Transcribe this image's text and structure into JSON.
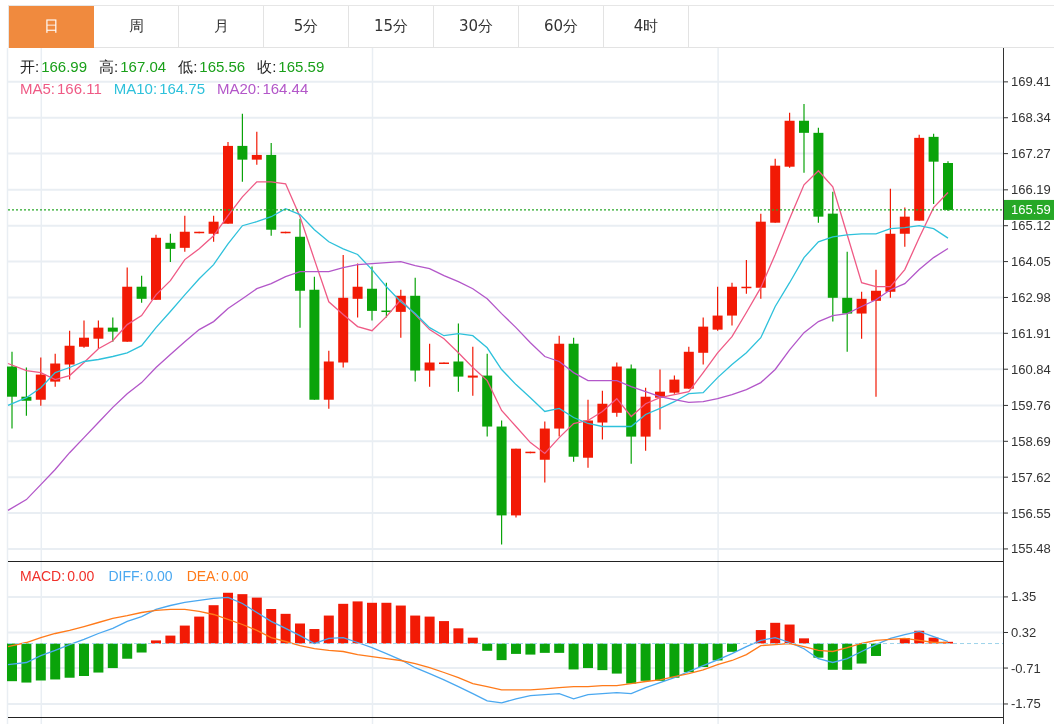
{
  "tabs": [
    {
      "label": "日",
      "selected": true
    },
    {
      "label": "周",
      "selected": false
    },
    {
      "label": "月",
      "selected": false
    },
    {
      "label": "5分",
      "selected": false
    },
    {
      "label": "15分",
      "selected": false
    },
    {
      "label": "30分",
      "selected": false
    },
    {
      "label": "60分",
      "selected": false
    },
    {
      "label": "4时",
      "selected": false
    }
  ],
  "ohlc_legend": [
    {
      "label": "开:",
      "value": "166.99"
    },
    {
      "label": "高:",
      "value": "167.04"
    },
    {
      "label": "低:",
      "value": "165.56"
    },
    {
      "label": "收:",
      "value": "165.59"
    }
  ],
  "ma_legend": [
    {
      "value": "166.11",
      "color": "#ef5a85"
    },
    {
      "value": "164.75",
      "color": "#2ec1db"
    },
    {
      "value": "164.44",
      "color": "#b357c9"
    }
  ],
  "main_chart": {
    "chart_data": {
      "type": "candlestick",
      "ylim": [
        155.12,
        170.42
      ],
      "grid": true,
      "yticks": [
        169.41,
        168.34,
        167.27,
        166.19,
        165.12,
        164.05,
        162.98,
        161.91,
        160.84,
        159.76,
        158.69,
        157.62,
        156.55,
        155.48
      ],
      "series": [
        {
          "name": "MA5:",
          "type": "line",
          "color": "#ef5a85",
          "values": [
            161.01,
            160.8,
            160.74,
            160.53,
            160.65,
            161.04,
            161.45,
            161.69,
            162.17,
            162.44,
            163.06,
            163.48,
            164.11,
            164.43,
            164.82,
            165.42,
            165.98,
            166.43,
            166.43,
            166.37,
            165.39,
            164.11,
            162.85,
            162.47,
            162.11,
            161.99,
            162.41,
            162.91,
            162.47,
            162.02,
            161.75,
            161.33,
            160.89,
            160.5,
            159.61,
            159.13,
            158.65,
            158.33,
            158.8,
            159.22,
            159.31,
            159.58,
            159.96,
            159.43,
            159.81,
            159.99,
            160.08,
            160.17,
            160.74,
            161.33,
            161.81,
            162.53,
            163.27,
            164.26,
            165.33,
            166.34,
            166.76,
            166.28,
            164.85,
            163.42,
            163.3,
            163.3,
            163.81,
            164.76,
            165.66,
            166.11
          ]
        },
        {
          "name": "MA10:",
          "type": "line",
          "color": "#2ec1db",
          "values": [
            159.76,
            159.99,
            160.29,
            160.74,
            160.89,
            161.07,
            161.13,
            161.22,
            161.33,
            161.54,
            162.08,
            162.56,
            163.06,
            163.54,
            163.96,
            164.58,
            165.12,
            165.24,
            165.39,
            165.63,
            165.45,
            165.0,
            164.64,
            164.43,
            164.26,
            163.81,
            163.3,
            162.85,
            162.5,
            162.08,
            161.84,
            161.9,
            161.84,
            161.48,
            160.83,
            160.38,
            159.99,
            159.58,
            159.67,
            159.4,
            159.22,
            159.13,
            159.13,
            159.13,
            159.49,
            159.67,
            159.87,
            160.11,
            160.14,
            160.59,
            160.98,
            161.33,
            161.78,
            162.71,
            163.42,
            164.17,
            164.64,
            164.79,
            164.85,
            164.88,
            164.88,
            165.03,
            165.06,
            165.12,
            165.03,
            164.75
          ]
        },
        {
          "name": "MA20:",
          "type": "line",
          "color": "#b357c9",
          "values": [
            156.63,
            156.95,
            157.4,
            157.85,
            158.35,
            158.8,
            159.25,
            159.7,
            160.11,
            160.44,
            160.89,
            161.28,
            161.66,
            162.02,
            162.26,
            162.65,
            162.94,
            163.24,
            163.39,
            163.6,
            163.75,
            163.75,
            163.75,
            163.87,
            163.96,
            163.99,
            164.02,
            164.05,
            163.93,
            163.84,
            163.63,
            163.45,
            163.24,
            162.94,
            162.5,
            162.08,
            161.63,
            161.22,
            161.07,
            160.74,
            160.5,
            160.5,
            160.5,
            160.32,
            160.17,
            160.02,
            159.93,
            159.85,
            159.87,
            159.96,
            160.08,
            160.23,
            160.44,
            160.83,
            161.42,
            161.93,
            162.26,
            162.44,
            162.5,
            162.71,
            162.91,
            163.21,
            163.39,
            163.81,
            164.17,
            164.44
          ]
        }
      ],
      "ohlc": [
        [
          160.92,
          161.36,
          159.07,
          160.02
        ],
        [
          160.02,
          160.89,
          159.45,
          159.9
        ],
        [
          159.93,
          161.19,
          159.75,
          160.68
        ],
        [
          160.47,
          161.3,
          160.32,
          161.01
        ],
        [
          160.98,
          161.99,
          160.53,
          161.54
        ],
        [
          161.51,
          162.29,
          161.48,
          161.78
        ],
        [
          161.75,
          162.29,
          161.45,
          162.08
        ],
        [
          162.08,
          162.38,
          161.66,
          161.96
        ],
        [
          161.66,
          163.87,
          161.66,
          163.3
        ],
        [
          163.3,
          163.63,
          162.82,
          162.94
        ],
        [
          162.91,
          164.85,
          162.91,
          164.76
        ],
        [
          164.61,
          164.88,
          164.04,
          164.43
        ],
        [
          164.46,
          165.42,
          164.34,
          164.94
        ],
        [
          164.93,
          164.94,
          164.93,
          164.94
        ],
        [
          164.88,
          165.42,
          164.64,
          165.24
        ],
        [
          165.18,
          167.62,
          165.18,
          167.5
        ],
        [
          167.5,
          168.46,
          166.43,
          167.09
        ],
        [
          167.09,
          167.92,
          166.94,
          167.23
        ],
        [
          167.23,
          167.59,
          164.82,
          165.0
        ],
        [
          164.93,
          164.94,
          164.93,
          164.94
        ],
        [
          164.79,
          165.33,
          162.08,
          163.18
        ],
        [
          163.21,
          163.6,
          159.93,
          159.93
        ],
        [
          159.93,
          161.39,
          159.66,
          161.07
        ],
        [
          161.04,
          164.25,
          160.89,
          162.97
        ],
        [
          162.94,
          163.99,
          162.38,
          163.3
        ],
        [
          163.24,
          163.9,
          162.29,
          162.58
        ],
        [
          162.59,
          163.42,
          162.38,
          162.58
        ],
        [
          162.55,
          163.21,
          161.78,
          163.03
        ],
        [
          163.03,
          163.57,
          160.47,
          160.8
        ],
        [
          160.8,
          161.6,
          160.32,
          161.04
        ],
        [
          161.03,
          161.04,
          161.03,
          161.04
        ],
        [
          161.07,
          162.2,
          160.17,
          160.62
        ],
        [
          160.59,
          161.51,
          160.05,
          160.65
        ],
        [
          160.65,
          161.3,
          158.83,
          159.13
        ],
        [
          159.13,
          159.31,
          155.61,
          156.48
        ],
        [
          156.48,
          158.47,
          156.42,
          158.47
        ],
        [
          158.37,
          158.38,
          158.37,
          158.38
        ],
        [
          158.14,
          159.28,
          157.46,
          159.07
        ],
        [
          159.07,
          161.84,
          158.83,
          161.6
        ],
        [
          161.6,
          161.78,
          158.08,
          158.23
        ],
        [
          158.2,
          159.93,
          157.9,
          159.31
        ],
        [
          159.25,
          160.2,
          158.74,
          159.81
        ],
        [
          159.54,
          161.04,
          159.42,
          160.92
        ],
        [
          160.86,
          160.98,
          158.02,
          158.83
        ],
        [
          158.83,
          160.29,
          158.41,
          160.02
        ],
        [
          159.99,
          160.83,
          159.04,
          160.17
        ],
        [
          160.14,
          160.65,
          160.11,
          160.53
        ],
        [
          160.26,
          161.51,
          160.26,
          161.36
        ],
        [
          161.33,
          162.38,
          160.98,
          162.11
        ],
        [
          162.02,
          163.3,
          161.99,
          162.44
        ],
        [
          162.44,
          163.42,
          162.14,
          163.3
        ],
        [
          163.29,
          164.1,
          163.09,
          163.3
        ],
        [
          163.27,
          165.48,
          162.94,
          165.24
        ],
        [
          165.21,
          167.12,
          165.21,
          166.91
        ],
        [
          166.88,
          168.49,
          166.85,
          168.25
        ],
        [
          168.25,
          168.75,
          166.7,
          167.89
        ],
        [
          167.89,
          168.04,
          165.21,
          165.39
        ],
        [
          165.48,
          166.13,
          162.26,
          162.97
        ],
        [
          162.97,
          164.34,
          161.36,
          162.5
        ],
        [
          162.5,
          163.15,
          161.75,
          162.94
        ],
        [
          162.88,
          163.81,
          160.02,
          163.18
        ],
        [
          163.15,
          166.22,
          162.97,
          164.88
        ],
        [
          164.88,
          165.66,
          164.49,
          165.39
        ],
        [
          165.27,
          167.83,
          165.27,
          167.74
        ],
        [
          167.77,
          167.86,
          165.77,
          167.03
        ],
        [
          166.99,
          167.04,
          165.56,
          165.59
        ]
      ],
      "ref_lines": [
        {
          "axis": "y",
          "value": 165.59,
          "label": "165.59",
          "color": "#27a827"
        }
      ]
    }
  },
  "macd_legend": [
    {
      "value": "0.00",
      "color": "#f0302a"
    },
    {
      "value": "0.00",
      "color": "#4aa8f0"
    },
    {
      "value": "0.00",
      "color": "#ff7a1a"
    }
  ],
  "macd_chart": {
    "chart_data": {
      "type": "bar",
      "ylim": [
        -2.33,
        2.39
      ],
      "grid": true,
      "ref_lines": [
        {
          "axis": "y",
          "value": 0,
          "color": "#9dd3ea"
        }
      ],
      "yticks": [
        1.35,
        0.32,
        -0.71,
        -1.75
      ],
      "series": [
        {
          "name": "MACD:",
          "colors": [
            "#0aa30a",
            "#0aa30a",
            "#0aa30a",
            "#0aa30a",
            "#0aa30a",
            "#0aa30a",
            "#0aa30a",
            "#0aa30a",
            "#0aa30a",
            "#0aa30a",
            "#f21a05",
            "#f21a05",
            "#f21a05",
            "#f21a05",
            "#f21a05",
            "#f21a05",
            "#f21a05",
            "#f21a05",
            "#f21a05",
            "#f21a05",
            "#f21a05",
            "#f21a05",
            "#f21a05",
            "#f21a05",
            "#f21a05",
            "#f21a05",
            "#f21a05",
            "#f21a05",
            "#f21a05",
            "#f21a05",
            "#f21a05",
            "#f21a05",
            "#f21a05",
            "#0aa30a",
            "#0aa30a",
            "#0aa30a",
            "#0aa30a",
            "#0aa30a",
            "#0aa30a",
            "#0aa30a",
            "#0aa30a",
            "#0aa30a",
            "#0aa30a",
            "#0aa30a",
            "#0aa30a",
            "#0aa30a",
            "#0aa30a",
            "#0aa30a",
            "#0aa30a",
            "#0aa30a",
            "#0aa30a",
            null,
            "#f21a05",
            "#f21a05",
            "#f21a05",
            "#f21a05",
            "#0aa30a",
            "#0aa30a",
            "#0aa30a",
            "#0aa30a",
            "#0aa30a",
            null,
            "#f21a05",
            "#f21a05",
            "#f21a05",
            "#f21a05"
          ],
          "values": [
            -1.09,
            -1.13,
            -1.07,
            -1.04,
            -0.99,
            -0.94,
            -0.84,
            -0.71,
            -0.44,
            -0.26,
            0.09,
            0.23,
            0.52,
            0.78,
            1.11,
            1.47,
            1.43,
            1.33,
            1.0,
            0.86,
            0.58,
            0.42,
            0.81,
            1.15,
            1.22,
            1.18,
            1.18,
            1.1,
            0.81,
            0.78,
            0.65,
            0.44,
            0.17,
            -0.21,
            -0.48,
            -0.3,
            -0.32,
            -0.27,
            -0.27,
            -0.75,
            -0.71,
            -0.77,
            -0.87,
            -1.16,
            -1.08,
            -1.08,
            -0.99,
            -0.83,
            -0.68,
            -0.49,
            -0.24,
            null,
            0.39,
            0.6,
            0.55,
            0.15,
            -0.41,
            -0.76,
            -0.76,
            -0.58,
            -0.36,
            null,
            0.16,
            0.37,
            0.17,
            0.05
          ]
        },
        {
          "name": "DIFF:",
          "type": "line",
          "color": "#4aa8f0",
          "values": [
            -0.61,
            -0.55,
            -0.35,
            -0.2,
            -0.03,
            0.12,
            0.29,
            0.44,
            0.64,
            0.78,
            0.99,
            1.1,
            1.19,
            1.25,
            1.31,
            1.34,
            1.16,
            0.9,
            0.64,
            0.44,
            0.23,
            0.0,
            0.15,
            0.17,
            0.03,
            -0.12,
            -0.29,
            -0.47,
            -0.7,
            -0.87,
            -1.05,
            -1.25,
            -1.45,
            -1.66,
            -1.72,
            -1.6,
            -1.51,
            -1.48,
            -1.45,
            -1.6,
            -1.48,
            -1.45,
            -1.42,
            -1.45,
            -1.28,
            -1.13,
            -0.99,
            -0.81,
            -0.64,
            -0.47,
            -0.29,
            -0.09,
            0.09,
            0.17,
            0.03,
            -0.15,
            -0.44,
            -0.55,
            -0.44,
            -0.23,
            -0.03,
            0.15,
            0.26,
            0.35,
            0.2,
            0.06
          ]
        },
        {
          "name": "DEA:",
          "type": "line",
          "color": "#ff7a1a",
          "values": [
            -0.09,
            0.03,
            0.17,
            0.29,
            0.38,
            0.49,
            0.61,
            0.73,
            0.81,
            0.9,
            0.96,
            0.99,
            0.99,
            0.93,
            0.84,
            0.7,
            0.55,
            0.38,
            0.17,
            0.06,
            -0.06,
            -0.15,
            -0.2,
            -0.23,
            -0.32,
            -0.38,
            -0.44,
            -0.49,
            -0.58,
            -0.7,
            -0.84,
            -0.99,
            -1.16,
            -1.25,
            -1.34,
            -1.34,
            -1.34,
            -1.31,
            -1.28,
            -1.25,
            -1.25,
            -1.22,
            -1.22,
            -1.16,
            -1.1,
            -1.05,
            -0.96,
            -0.87,
            -0.76,
            -0.61,
            -0.49,
            -0.32,
            -0.06,
            -0.03,
            0.0,
            -0.09,
            -0.2,
            -0.23,
            -0.12,
            0.0,
            0.09,
            0.12,
            0.15,
            0.09,
            0.03,
            0.03
          ]
        }
      ]
    }
  }
}
